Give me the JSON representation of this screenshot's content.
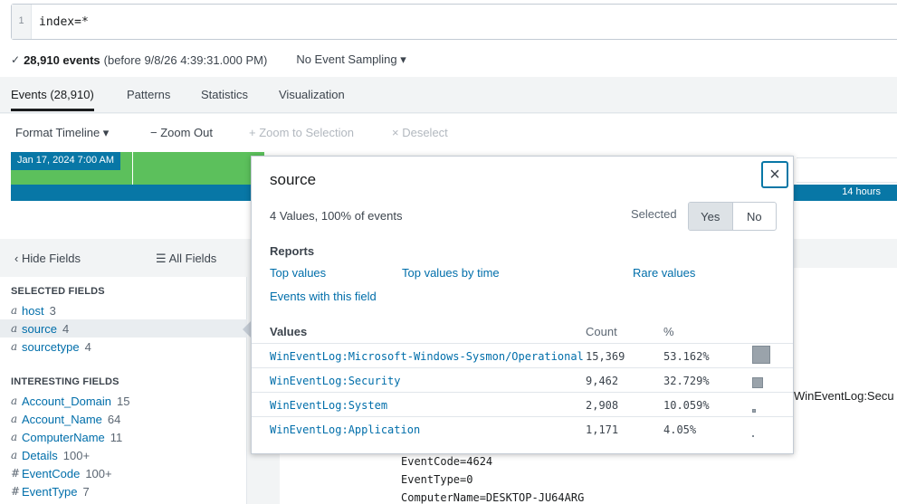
{
  "search": {
    "line_number": "1",
    "query": "index=*"
  },
  "meta": {
    "check": "✓",
    "event_count": "28,910 events",
    "before_text": "(before 9/8/26 4:39:31.000 PM)",
    "sampling": "No Event Sampling ▾"
  },
  "tabs": [
    {
      "label": "Events (28,910)",
      "active": true
    },
    {
      "label": "Patterns"
    },
    {
      "label": "Statistics"
    },
    {
      "label": "Visualization"
    }
  ],
  "timeline_toolbar": {
    "format": "Format Timeline ▾",
    "zoom_out": "− Zoom Out",
    "zoom_selection": "+ Zoom to Selection",
    "deselect": "× Deselect"
  },
  "timeline": {
    "date_label": "Jan 17, 2024 7:00 AM",
    "span_label": "14 hours",
    "colors": {
      "green": "#5cc05c",
      "blue": "#0877a6"
    }
  },
  "fields": {
    "hide_label": "Hide Fields",
    "all_label": "All Fields",
    "selected_title": "SELECTED FIELDS",
    "selected": [
      {
        "type": "a",
        "name": "host",
        "count": "3"
      },
      {
        "type": "a",
        "name": "source",
        "count": "4"
      },
      {
        "type": "a",
        "name": "sourcetype",
        "count": "4"
      }
    ],
    "interesting_title": "INTERESTING FIELDS",
    "interesting": [
      {
        "type": "a",
        "name": "Account_Domain",
        "count": "15"
      },
      {
        "type": "a",
        "name": "Account_Name",
        "count": "64"
      },
      {
        "type": "a",
        "name": "ComputerName",
        "count": "11"
      },
      {
        "type": "a",
        "name": "Details",
        "count": "100+"
      },
      {
        "type": "#",
        "name": "EventCode",
        "count": "100+"
      },
      {
        "type": "#",
        "name": "EventType",
        "count": "7"
      }
    ]
  },
  "events": {
    "lines": [
      "EventCode=4624",
      "EventType=0",
      "ComputerName=DESKTOP-JU64ARG"
    ],
    "snippet": "WinEventLog:Secu"
  },
  "popover": {
    "title": "source",
    "close": "×",
    "summary": "4 Values, 100% of events",
    "selected_label": "Selected",
    "yes": "Yes",
    "no": "No",
    "reports_title": "Reports",
    "reports": {
      "top_values": "Top values",
      "top_by_time": "Top values by time",
      "rare_values": "Rare values",
      "events_with_field": "Events with this field"
    },
    "table": {
      "col_values": "Values",
      "col_count": "Count",
      "col_pct": "%",
      "rows": [
        {
          "value": "WinEventLog:Microsoft-Windows-Sysmon/Operational",
          "count": "15,369",
          "pct": "53.162%",
          "fraction": 0.53162
        },
        {
          "value": "WinEventLog:Security",
          "count": "9,462",
          "pct": "32.729%",
          "fraction": 0.32729
        },
        {
          "value": "WinEventLog:System",
          "count": "2,908",
          "pct": "10.059%",
          "fraction": 0.10059
        },
        {
          "value": "WinEventLog:Application",
          "count": "1,171",
          "pct": "4.05%",
          "fraction": 0.0405
        }
      ]
    }
  }
}
